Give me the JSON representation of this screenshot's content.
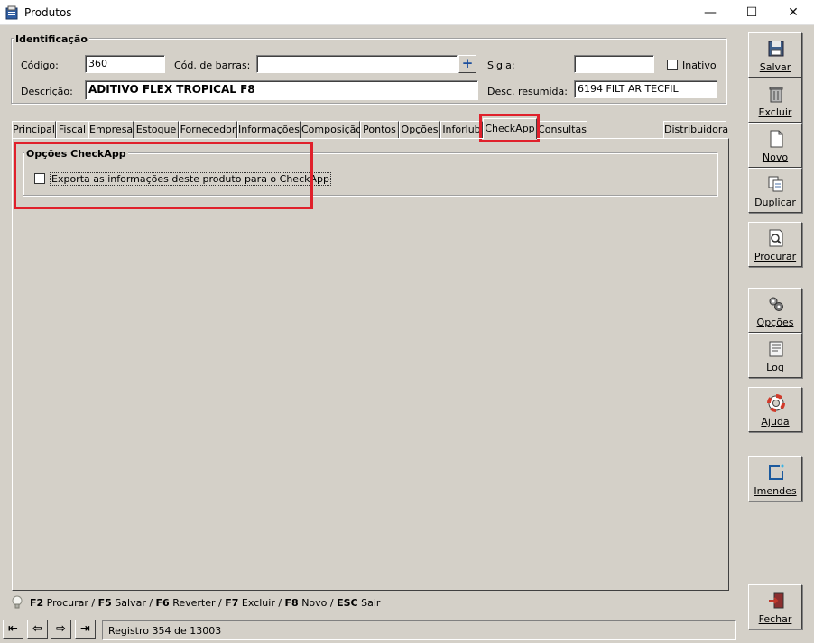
{
  "window": {
    "title": "Produtos",
    "minimize_glyph": "—",
    "maximize_glyph": "☐",
    "close_glyph": "✕"
  },
  "identificacao": {
    "legend": "Identificação",
    "codigo_label": "Código:",
    "codigo_value": "360",
    "barras_label": "Cód. de barras:",
    "barras_value": "",
    "add_glyph": "+",
    "sigla_label": "Sigla:",
    "sigla_value": "",
    "inativo_label": "Inativo",
    "inativo_checked": false,
    "descricao_label": "Descrição:",
    "descricao_value": "ADITIVO FLEX TROPICAL F8",
    "desc_resumida_label": "Desc. resumida:",
    "desc_resumida_value": "6194 FILT AR TECFIL"
  },
  "tabs": [
    {
      "label": "Principal"
    },
    {
      "label": "Fiscal"
    },
    {
      "label": "Empresa"
    },
    {
      "label": "Estoque"
    },
    {
      "label": "Fornecedor"
    },
    {
      "label": "Informações"
    },
    {
      "label": "Composição"
    },
    {
      "label": "Pontos"
    },
    {
      "label": "Opções"
    },
    {
      "label": "Inforlub"
    },
    {
      "label": "CheckApp"
    },
    {
      "label": "Consultas"
    },
    {
      "label": "Distribuidora"
    }
  ],
  "active_tab": "CheckApp",
  "checkapp": {
    "legend": "Opções CheckApp",
    "export_label": "Exporta as informações deste produto para o CheckApp",
    "export_checked": false
  },
  "shortcuts": {
    "f2_key": "F2",
    "f2_text": " Procurar / ",
    "f5_key": "F5",
    "f5_text": " Salvar / ",
    "f6_key": "F6",
    "f6_text": " Reverter / ",
    "f7_key": "F7",
    "f7_text": " Excluir / ",
    "f8_key": "F8",
    "f8_text": " Novo / ",
    "esc_key": "ESC",
    "esc_text": " Sair"
  },
  "navigation": {
    "first_glyph": "⇤",
    "prev_glyph": "⇦",
    "next_glyph": "⇨",
    "last_glyph": "⇥",
    "status_text": "Registro 354 de 13003"
  },
  "sidebar": {
    "salvar": "Salvar",
    "excluir": "Excluir",
    "novo": "Novo",
    "duplicar": "Duplicar",
    "procurar": "Procurar",
    "opcoes": "Opções",
    "log": "Log",
    "ajuda": "Ajuda",
    "imendes": "Imendes",
    "fechar": "Fechar"
  },
  "colors": {
    "background": "#d4d0c8",
    "highlight_red": "#e0202b",
    "accent_blue": "#1d4f9e"
  }
}
